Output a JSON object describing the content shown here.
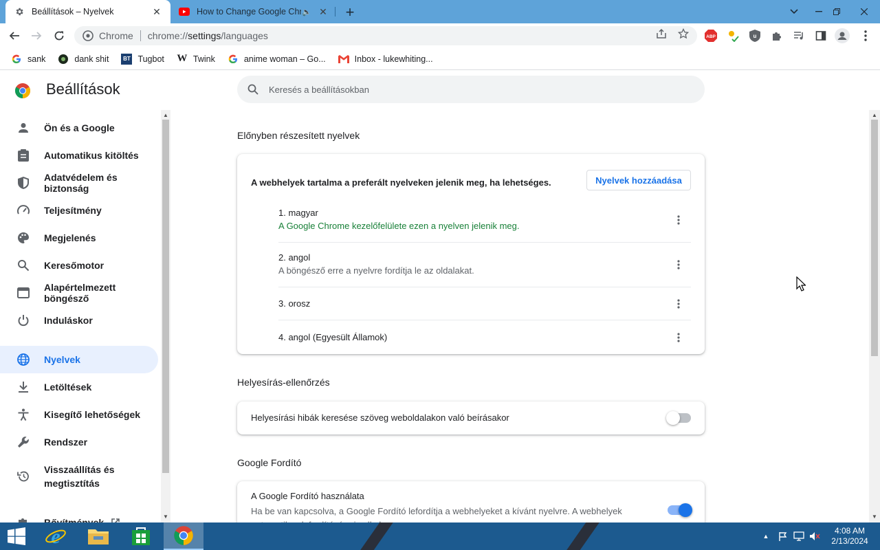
{
  "browser": {
    "tabs": [
      {
        "title": "Beállítások – Nyelvek",
        "active": true
      },
      {
        "title": "How to Change Google Chrome",
        "active": false
      }
    ],
    "omnibox": {
      "site_label": "Chrome",
      "url_scheme": "chrome://",
      "url_host": "settings",
      "url_path": "/languages"
    },
    "bookmarks": [
      {
        "label": "sank",
        "icon": "google-icon"
      },
      {
        "label": "dank shit",
        "icon": "site-icon"
      },
      {
        "label": "Tugbot",
        "icon": "bt-icon"
      },
      {
        "label": "Twink",
        "icon": "wikipedia-icon"
      },
      {
        "label": "anime woman – Go...",
        "icon": "google-icon"
      },
      {
        "label": "Inbox - lukewhiting...",
        "icon": "gmail-icon"
      }
    ]
  },
  "settings": {
    "title": "Beállítások",
    "search_placeholder": "Keresés a beállításokban",
    "sidebar": [
      {
        "label": "Ön és a Google",
        "icon": "person-icon"
      },
      {
        "label": "Automatikus kitöltés",
        "icon": "clipboard-icon"
      },
      {
        "label": "Adatvédelem és biztonság",
        "icon": "shield-icon"
      },
      {
        "label": "Teljesítmény",
        "icon": "speedometer-icon"
      },
      {
        "label": "Megjelenés",
        "icon": "palette-icon"
      },
      {
        "label": "Keresőmotor",
        "icon": "search-icon"
      },
      {
        "label": "Alapértelmezett böngésző",
        "icon": "browser-icon"
      },
      {
        "label": "Induláskor",
        "icon": "power-icon"
      },
      {
        "label": "Nyelvek",
        "icon": "globe-icon",
        "active": true
      },
      {
        "label": "Letöltések",
        "icon": "download-icon"
      },
      {
        "label": "Kisegítő lehetőségek",
        "icon": "accessibility-icon"
      },
      {
        "label": "Rendszer",
        "icon": "wrench-icon"
      },
      {
        "label": "Visszaállítás és megtisztítás",
        "label_line1": "Visszaállítás és",
        "label_line2": "megtisztítás",
        "icon": "restore-icon"
      },
      {
        "label": "Bővítmények",
        "icon": "puzzle-icon"
      }
    ],
    "preferred_languages": {
      "section_title": "Előnyben részesített nyelvek",
      "description": "A webhelyek tartalma a preferált nyelveken jelenik meg, ha lehetséges.",
      "add_button": "Nyelvek hozzáadása",
      "languages": [
        {
          "name": "1. magyar",
          "note": "A Google Chrome kezelőfelülete ezen a nyelven jelenik meg.",
          "note_style": "green"
        },
        {
          "name": "2. angol",
          "note": "A böngésző erre a nyelvre fordítja le az oldalakat.",
          "note_style": "grey"
        },
        {
          "name": "3. orosz",
          "note": ""
        },
        {
          "name": "4. angol (Egyesült Államok)",
          "note": ""
        }
      ]
    },
    "spell_check": {
      "section_title": "Helyesírás-ellenőrzés",
      "label": "Helyesírási hibák keresése szöveg weboldalakon való beírásakor",
      "enabled": false
    },
    "google_translate": {
      "section_title": "Google Fordító",
      "label": "A Google Fordító használata",
      "description": "Ha be van kapcsolva, a Google Fordító lefordítja a webhelyeket a kívánt nyelvre. A webhelyek",
      "description_line2": "automatikus lefordítására is alkalmas",
      "enabled": true
    }
  },
  "taskbar": {
    "apps": [
      "start-icon",
      "internet-explorer-icon",
      "file-explorer-icon",
      "store-icon",
      "chrome-icon"
    ],
    "time": "4:08 AM",
    "date": "2/13/2024"
  },
  "colors": {
    "accent": "#1a73e8",
    "tab_strip": "#5ea3d9",
    "sidebar_active_bg": "#e8f0fe",
    "green_note": "#188038",
    "taskbar": "#1c5a8f"
  }
}
